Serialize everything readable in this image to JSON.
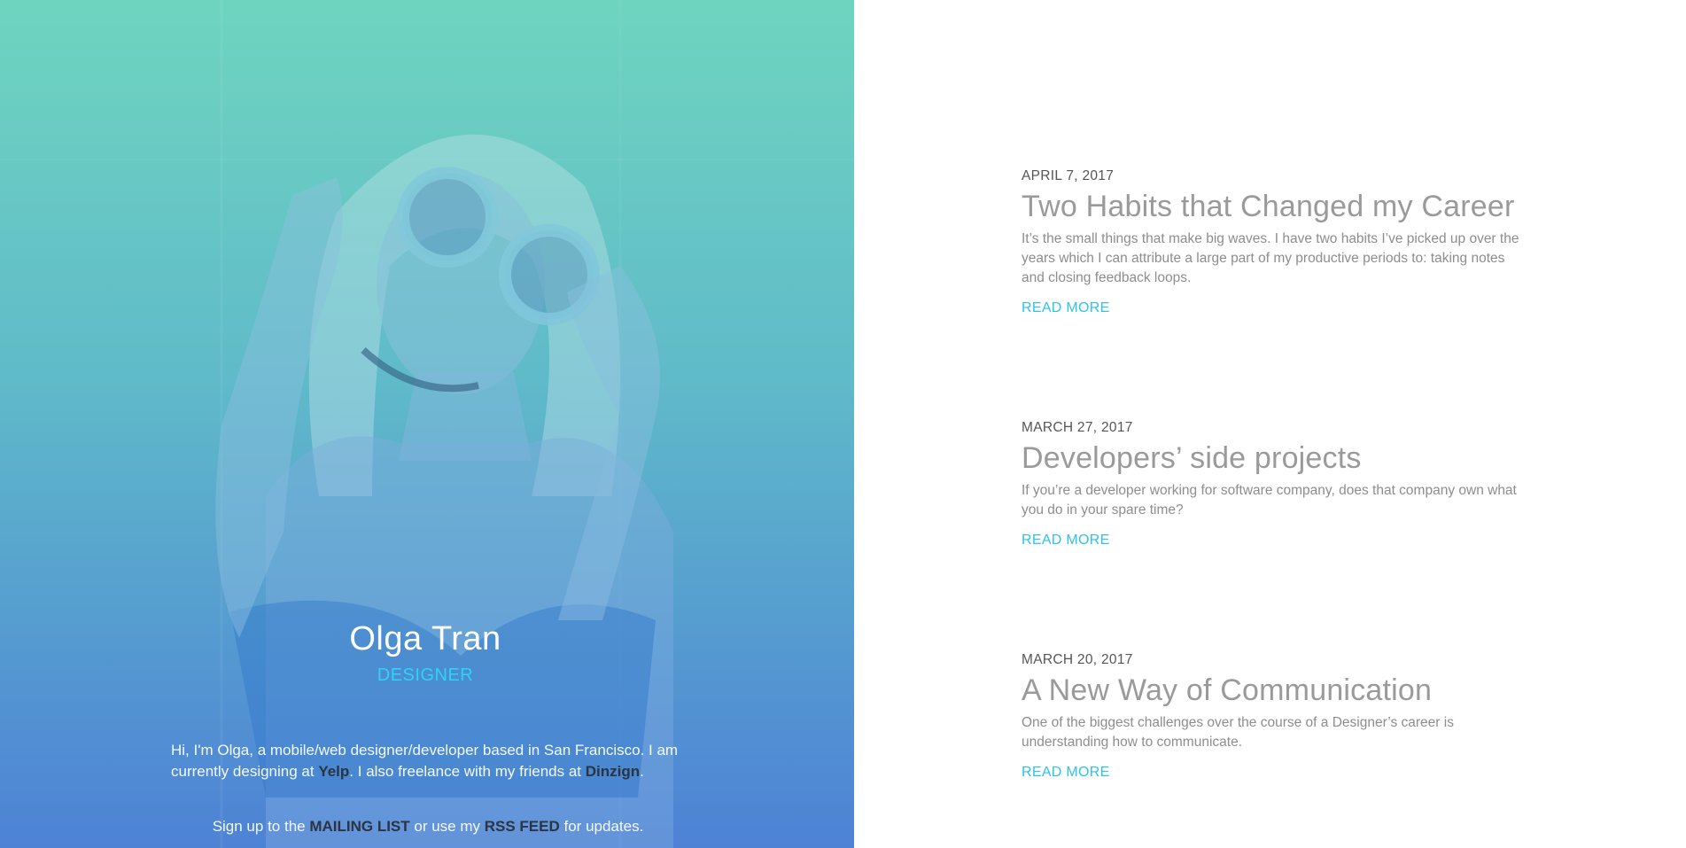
{
  "profile": {
    "name": "Olga Tran",
    "role": "DESIGNER",
    "bio_prefix": "Hi, I'm Olga, a mobile/web designer/developer based in San Francisco. I am currently designing at ",
    "bio_company": "Yelp",
    "bio_middle": ". I also freelance with my friends at ",
    "bio_freelance": "Dinzign",
    "bio_suffix": ".",
    "signup_prefix": "Sign up to the ",
    "signup_mailing": "MAILING LIST",
    "signup_middle": " or use my ",
    "signup_rss": "RSS FEED",
    "signup_suffix": " for updates."
  },
  "posts": [
    {
      "date": "APRIL 7, 2017",
      "title": "Two Habits that Changed my Career",
      "excerpt": "It’s the small things that make big waves. I have two habits I’ve picked up over the years which I can attribute a large part of my productive periods to: taking notes and closing feedback loops.",
      "read_more": "READ MORE"
    },
    {
      "date": "MARCH 27, 2017",
      "title": "Developers’ side projects",
      "excerpt": "If you’re a developer working for software company, does that company own what you do in your spare time?",
      "read_more": "READ MORE"
    },
    {
      "date": "MARCH 20, 2017",
      "title": "A New Way of Communication",
      "excerpt": "One of the biggest challenges over the course of a Designer’s career is understanding how to communicate.",
      "read_more": "READ MORE"
    }
  ],
  "colors": {
    "accent": "#2ec3ec",
    "dark_link": "#2b3442",
    "hero_top": "#6fd3bf",
    "hero_bottom": "#4a7bd3"
  }
}
